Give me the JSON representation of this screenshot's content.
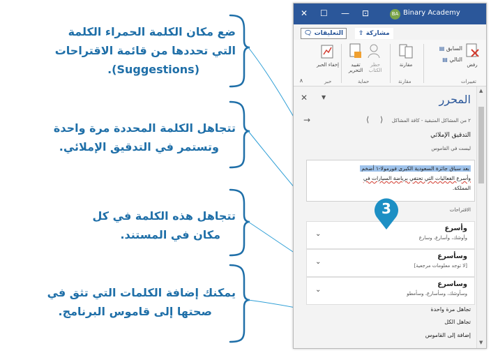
{
  "callouts": [
    {
      "lines": [
        "ضع مكان الكلمة الحمراء الكلمة",
        "التي تحددها من قائمة الاقتراحات",
        "(Suggestions)."
      ]
    },
    {
      "lines": [
        "تتجاهل الكلمة المحددة مرة واحدة",
        "وتستمر في التدقيق الإملائي."
      ]
    },
    {
      "lines": [
        "تتجاهل هذه الكلمة في كل",
        "مكان في المستند."
      ]
    },
    {
      "lines": [
        "يمكنك إضافة الكلمات التي تثق في",
        "صحتها إلى قاموس البرنامج."
      ]
    }
  ],
  "window": {
    "user_initials": "BA",
    "app_title": "Binary Academy",
    "share_label": "مشاركة",
    "comments_label": "التعليقات",
    "ribbon": {
      "previous_label": "السابق",
      "next_label": "التالي",
      "reject_label": "رفض",
      "compare_label": "مقارنة",
      "block_authors_label": "حظر الكتاب",
      "restrict_editing_label": "تقييد التحرير",
      "hide_ink_label": "إخفاء الحبر",
      "groups": [
        "تغييرات",
        "مقارنة",
        "حماية",
        "حبر"
      ]
    },
    "editor": {
      "title": "المحرر",
      "nav_text": "٢ من المشاكل المتبقية - كافة المشاكل",
      "section_title": "التدقيق الإملائي",
      "not_in_dictionary": "ليست في القاموس",
      "context_line1": "بعد سباق جائزة السعودية الكبرى فورمولا-١ أضخم",
      "context_line2": "وأسرع الفعاليات التي تحتفي برياضة السيارات في",
      "context_line3": "المملكة.",
      "suggestions_label": "الاقتراحات",
      "suggestions": [
        {
          "word": "وأسرع",
          "sub": "وأوشك، وأسارع، وسارع"
        },
        {
          "word": "وسأسرع",
          "sub": "[لا توجد معلومات مرجعية]"
        },
        {
          "word": "وساسرع",
          "sub": "وسأوشك، وسأسارع، وسأمطو"
        }
      ],
      "ignore_once": "تجاهل مرة واحدة",
      "ignore_all": "تجاهل الكل",
      "add_to_dictionary": "إضافة إلى القاموس"
    }
  },
  "badge_number": "3",
  "colors": {
    "callout": "#1f6fa8",
    "titlebar": "#2b579a",
    "highlight": "#9fc3eb",
    "badge": "#1d8fc4"
  }
}
